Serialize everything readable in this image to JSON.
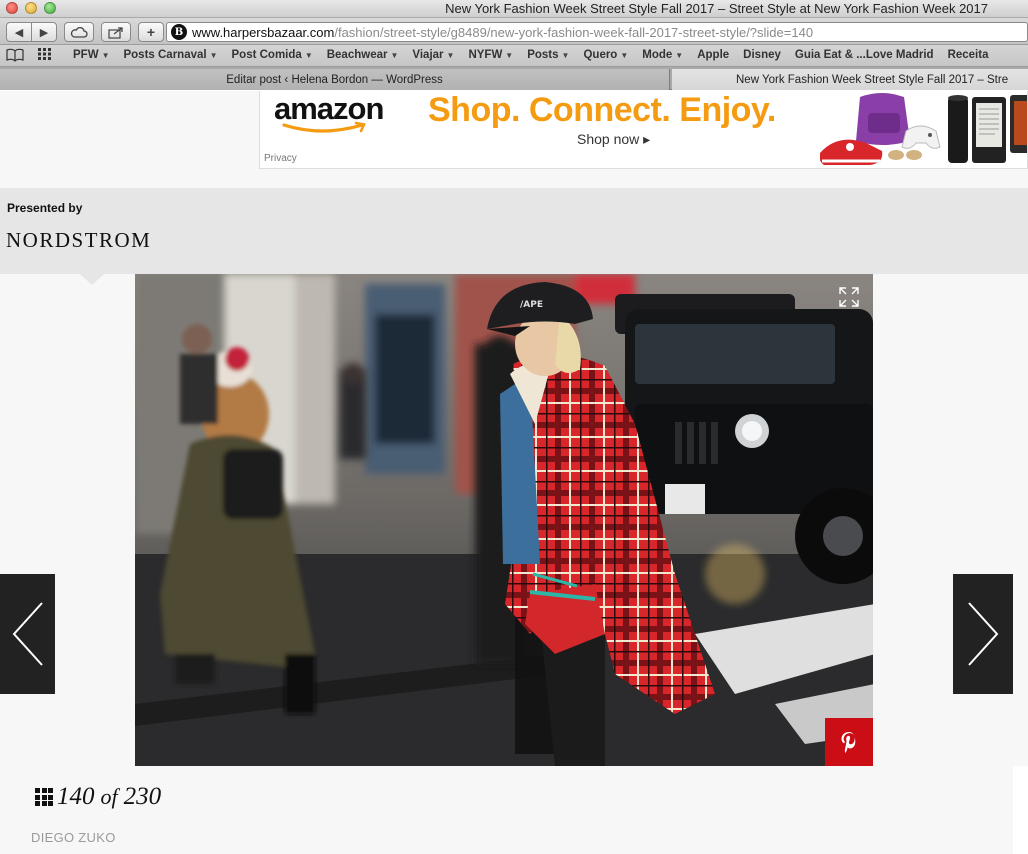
{
  "window": {
    "title": "New York Fashion Week Street Style Fall 2017 – Street Style at New York Fashion Week 2017"
  },
  "toolbar": {
    "back_icon": "chevron-left-icon",
    "forward_icon": "chevron-right-icon",
    "plus_label": "+",
    "url_domain": "www.harpersbazaar.com",
    "url_path": "/fashion/street-style/g8489/new-york-fashion-week-fall-2017-street-style/?slide=140",
    "site_badge": "B"
  },
  "bookmarks": {
    "items": [
      {
        "label": "PFW",
        "dropdown": true
      },
      {
        "label": "Posts Carnaval",
        "dropdown": true
      },
      {
        "label": "Post Comida",
        "dropdown": true
      },
      {
        "label": "Beachwear",
        "dropdown": true
      },
      {
        "label": "Viajar",
        "dropdown": true
      },
      {
        "label": "NYFW",
        "dropdown": true
      },
      {
        "label": "Posts",
        "dropdown": true
      },
      {
        "label": "Quero",
        "dropdown": true
      },
      {
        "label": "Mode",
        "dropdown": true
      },
      {
        "label": "Apple",
        "dropdown": false
      },
      {
        "label": "Disney",
        "dropdown": false
      },
      {
        "label": "Guia Eat & ...Love Madrid",
        "dropdown": false
      },
      {
        "label": "Receita",
        "dropdown": false
      }
    ]
  },
  "tabs": [
    {
      "label": "Editar post ‹ Helena Bordon — WordPress",
      "active": false
    },
    {
      "label": "New York Fashion Week Street Style Fall 2017 – Stre",
      "active": true
    }
  ],
  "ad": {
    "brand": "amazon",
    "headline": "Shop. Connect. Enjoy.",
    "cta": "Shop now ▸",
    "privacy": "Privacy"
  },
  "sponsor": {
    "label": "Presented by",
    "name": "NORDSTROM"
  },
  "gallery": {
    "current": "140",
    "of": "of",
    "total": "230",
    "credit": "DIEGO ZUKO",
    "pin_icon": "pinterest-icon",
    "expand_icon": "expand-icon"
  },
  "colors": {
    "ad_orange": "#f59b12",
    "pin_red": "#cb0d16",
    "nav_dark": "#222222",
    "sponsor_band": "#e6e6e6"
  }
}
